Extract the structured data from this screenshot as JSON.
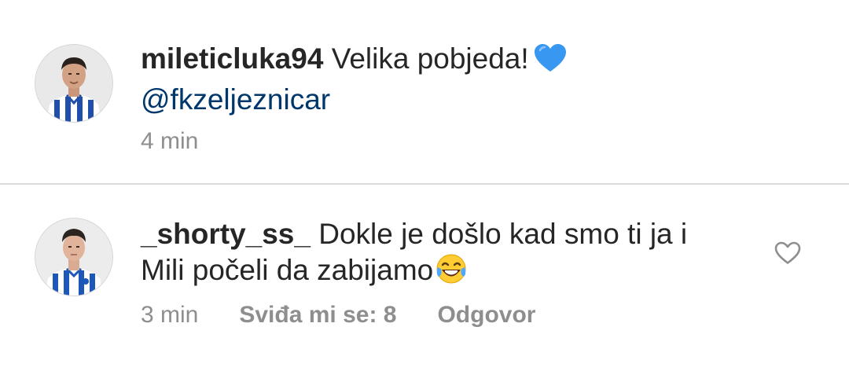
{
  "comments": [
    {
      "username": "mileticluka94",
      "text": "Velika pobjeda!",
      "emoji": "blue-heart-emoji",
      "mention": "@fkzeljeznicar",
      "time": "4 min"
    },
    {
      "username": "_shorty_ss_",
      "text_line1": "Dokle je došlo kad smo ti ja i",
      "text_line2": "Mili počeli da zabijamo",
      "emoji": "tears-of-joy-emoji",
      "time": "3 min",
      "likes_label": "Sviđa mi se: 8",
      "reply_label": "Odgovor",
      "like_icon": "heart-outline-icon"
    }
  ],
  "colors": {
    "text": "#262626",
    "meta": "#8e8e8e",
    "mention": "#00376b",
    "divider": "#dbdbdb",
    "blue_heart": "#3897f0"
  }
}
